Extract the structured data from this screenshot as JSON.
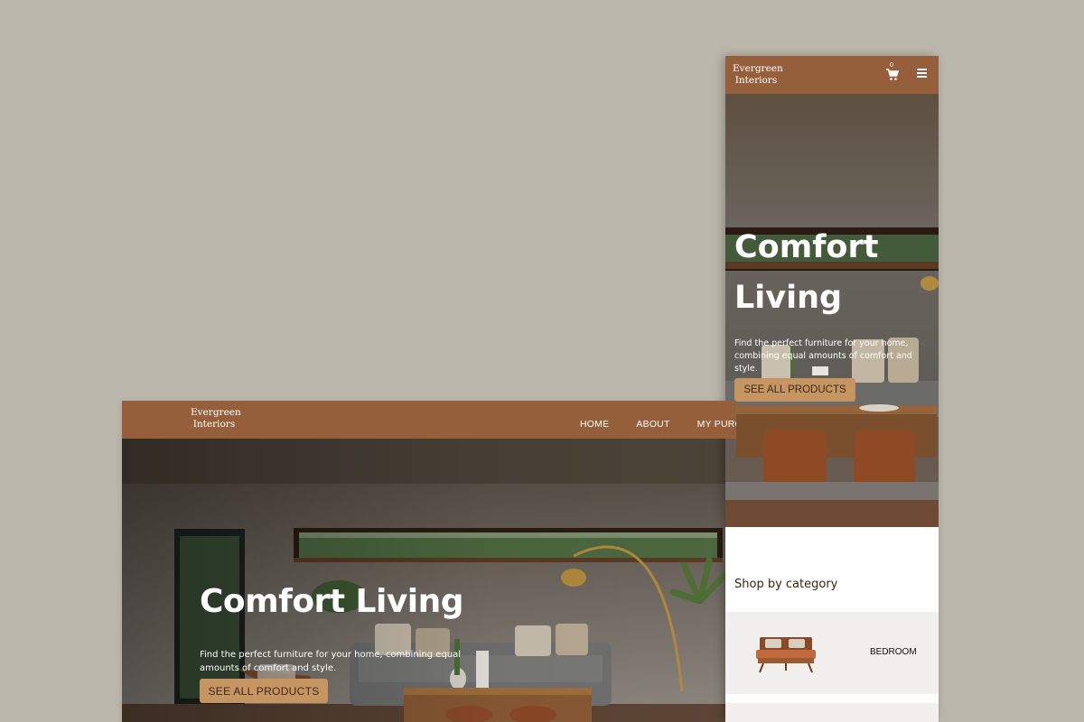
{
  "brand": {
    "line1": "Evergreen",
    "line2": "Interiors"
  },
  "desktop": {
    "nav": [
      "HOME",
      "ABOUT",
      "MY PURC"
    ],
    "hero": {
      "title": "Comfort Living",
      "subtitle": "Find the perfect furniture for your home, combining equal amounts of comfort and style.",
      "cta": "SEE ALL PRODUCTS"
    }
  },
  "mobile": {
    "cart_count": "0",
    "hero": {
      "title": "Comfort Living",
      "subtitle": "Find the perfect furniture for your home, combining equal amounts of comfort and style.",
      "cta": "SEE ALL PRODUCTS"
    },
    "shop_heading": "Shop by category",
    "categories": [
      "BEDROOM"
    ]
  },
  "colors": {
    "background": "#bcb7ac",
    "header": "#955f3c",
    "button": "#c69562",
    "card": "#f1f0ee"
  },
  "icons": [
    "cart-icon",
    "hamburger-menu-icon",
    "bed-icon"
  ]
}
